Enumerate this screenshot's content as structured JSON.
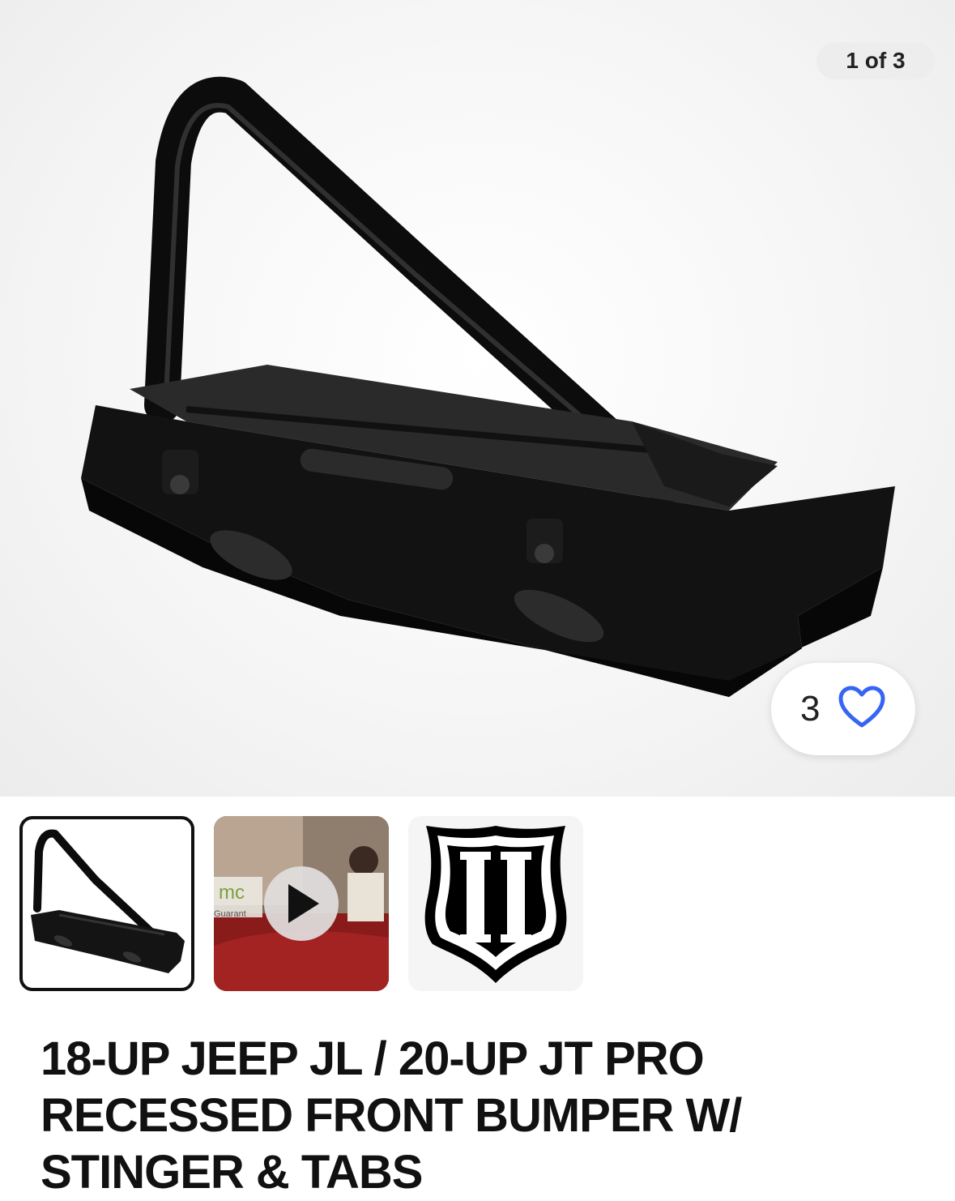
{
  "gallery": {
    "counter_text": "1 of 3",
    "watch_count": "3"
  },
  "thumbnails": [
    {
      "kind": "image",
      "selected": true
    },
    {
      "kind": "video",
      "overlay_text_1": "mc",
      "overlay_text_2": "Guarant"
    },
    {
      "kind": "logo"
    }
  ],
  "product": {
    "title": "18-UP JEEP JL / 20-UP JT PRO RECESSED FRONT BUMPER W/ STINGER & TABS"
  },
  "colors": {
    "heart": "#3665f3",
    "play_bg": "#e0dede",
    "product": "#111111"
  },
  "icons": {
    "watch": "heart-outline-icon",
    "play": "play-icon"
  }
}
